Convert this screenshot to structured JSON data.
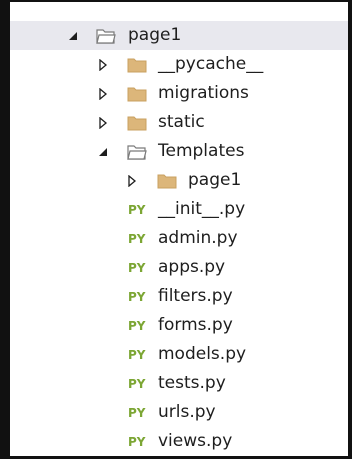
{
  "tree": {
    "root": {
      "label": "page1",
      "expanded": true
    },
    "folders": [
      {
        "label": "__pycache__",
        "expanded": false
      },
      {
        "label": "migrations",
        "expanded": false
      },
      {
        "label": "static",
        "expanded": false
      },
      {
        "label": "Templates",
        "expanded": true
      }
    ],
    "templates_child": {
      "label": "page1",
      "expanded": false
    },
    "files": [
      {
        "label": "__init__.py",
        "badge": "PY"
      },
      {
        "label": "admin.py",
        "badge": "PY"
      },
      {
        "label": "apps.py",
        "badge": "PY"
      },
      {
        "label": "filters.py",
        "badge": "PY"
      },
      {
        "label": "forms.py",
        "badge": "PY"
      },
      {
        "label": "models.py",
        "badge": "PY"
      },
      {
        "label": "tests.py",
        "badge": "PY"
      },
      {
        "label": "urls.py",
        "badge": "PY"
      },
      {
        "label": "views.py",
        "badge": "PY"
      }
    ]
  },
  "colors": {
    "selection": "#e8e8ee",
    "folder_fill": "#dcb67a",
    "py_badge": "#7ca634",
    "text": "#1e1e1e"
  }
}
